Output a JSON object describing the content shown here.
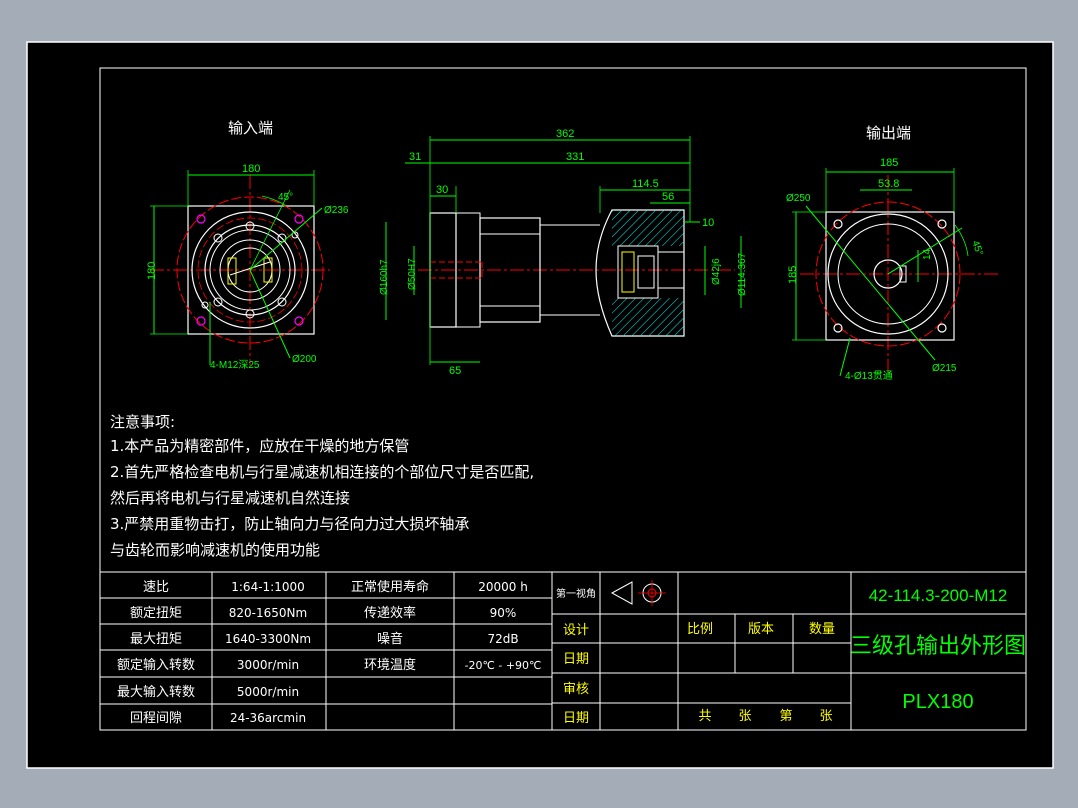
{
  "views": {
    "input_label": "输入端",
    "output_label": "输出端"
  },
  "dims_input": {
    "width": "180",
    "height": "180",
    "angle": "45°",
    "pcd_outer": "Ø236",
    "pcd_inner": "Ø200",
    "holes": "4-M12深25"
  },
  "dims_side": {
    "total": "362",
    "body": "331",
    "flange": "31",
    "spigot": "30",
    "out_len": "114.5",
    "key_len": "56",
    "shoulder": "10",
    "bore": "Ø50H7",
    "pilot": "Ø160h7",
    "shaft": "Ø42j6",
    "out_dia": "Ø114.367",
    "base": "65"
  },
  "dims_output": {
    "width": "185",
    "offset": "53.8",
    "height": "185",
    "pcd_outer": "Ø250",
    "angle": "45°",
    "key": "14",
    "holes": "4-Ø13贯通",
    "pcd_inner": "Ø215"
  },
  "notes": {
    "title": "注意事项:",
    "line1": "1.本产品为精密部件，应放在干燥的地方保管",
    "line2": "2.首先严格检查电机与行星减速机相连接的个部位尺寸是否匹配,",
    "line3": "然后再将电机与行星减速机自然连接",
    "line4": "3.严禁用重物击打，防止轴向力与径向力过大损坏轴承",
    "line5": "与齿轮而影响减速机的使用功能"
  },
  "specs": {
    "rows": [
      {
        "k1": "速比",
        "v1": "1:64-1:1000",
        "k2": "正常使用寿命",
        "v2": "20000 h"
      },
      {
        "k1": "额定扭矩",
        "v1": "820-1650Nm",
        "k2": "传递效率",
        "v2": "90%"
      },
      {
        "k1": "最大扭矩",
        "v1": "1640-3300Nm",
        "k2": "噪音",
        "v2": "72dB"
      },
      {
        "k1": "额定输入转数",
        "v1": "3000r/min",
        "k2": "环境温度",
        "v2": "-20℃ - +90℃"
      },
      {
        "k1": "最大输入转数",
        "v1": "5000r/min",
        "k2": "",
        "v2": ""
      },
      {
        "k1": "回程间隙",
        "v1": "24-36arcmin",
        "k2": "",
        "v2": ""
      }
    ]
  },
  "titleblock": {
    "projection": "第一视角",
    "design": "设计",
    "date1": "日期",
    "review": "审核",
    "date2": "日期",
    "scale": "比例",
    "version": "版本",
    "qty": "数量",
    "total": "共",
    "sheet1": "张",
    "page": "第",
    "sheet2": "张",
    "part_no": "42-114.3-200-M12",
    "title": "三级孔输出外形图",
    "model": "PLX180"
  },
  "colors": {
    "background": "#000000",
    "frame": "#ffffff",
    "dimension": "#00ff00",
    "centerline": "#ff0000",
    "hidden": "#ff00ff",
    "accent": "#00ffff"
  }
}
